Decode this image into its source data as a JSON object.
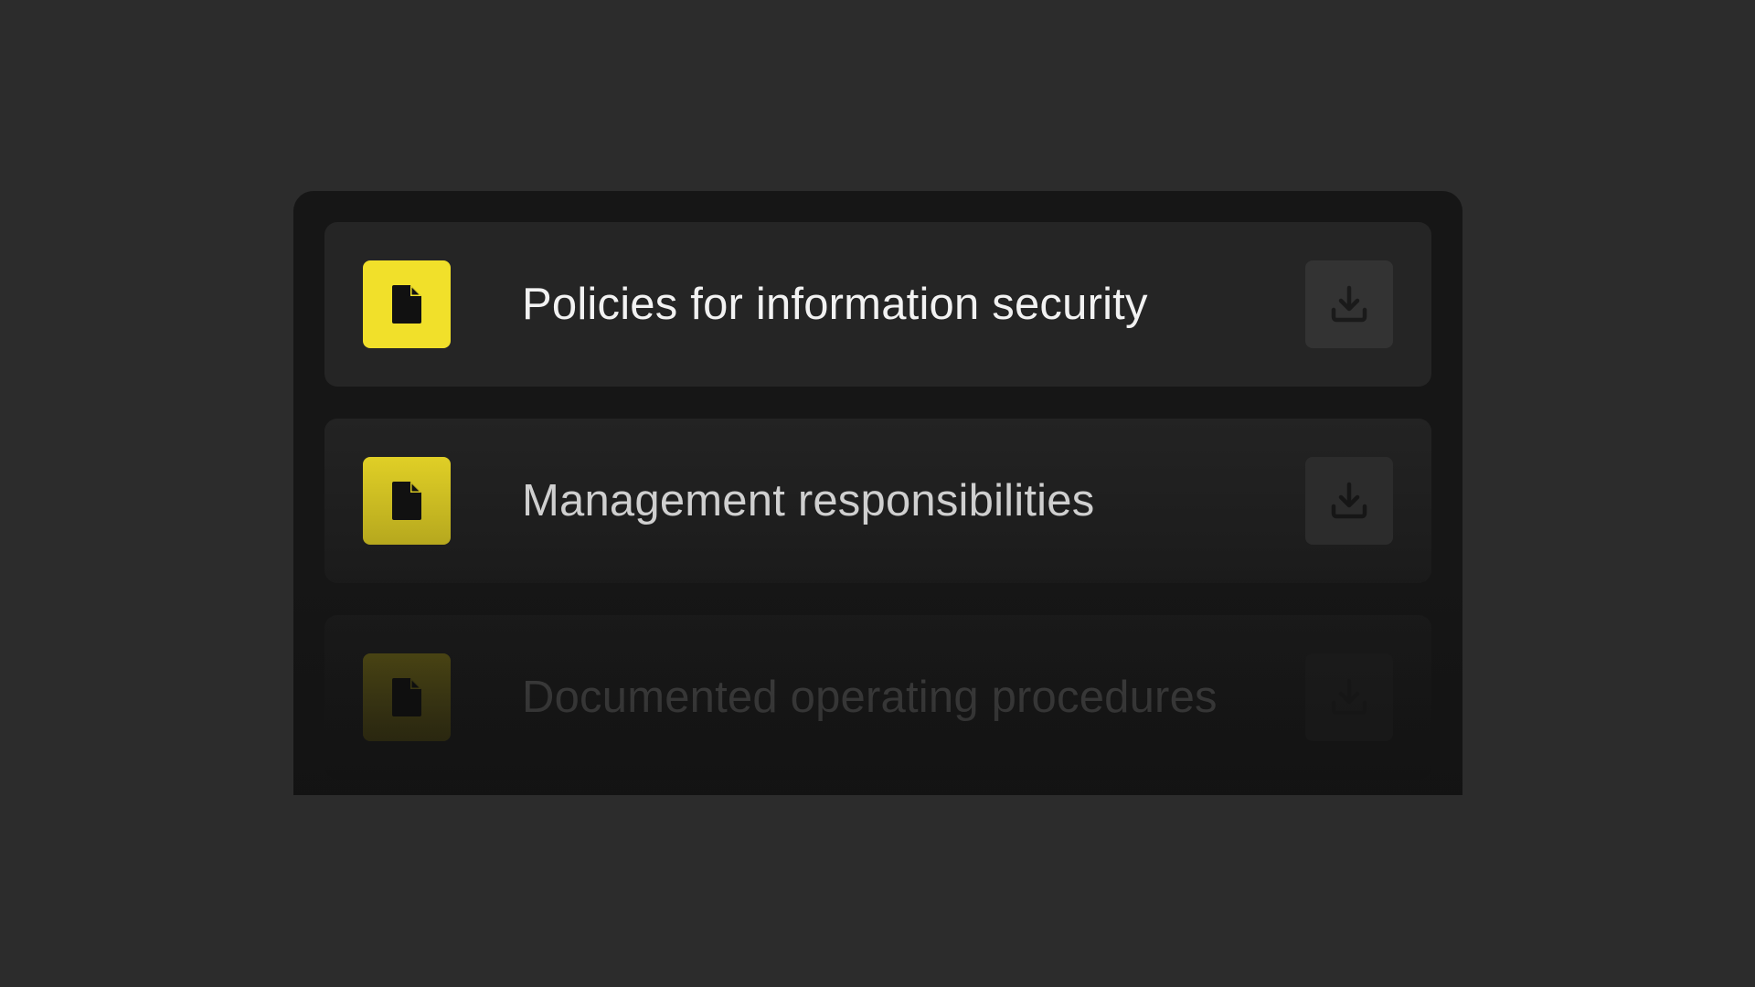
{
  "documents": {
    "items": [
      {
        "title": "Policies for information security",
        "icon": "document-icon",
        "action_icon": "download-icon"
      },
      {
        "title": "Management responsibilities",
        "icon": "document-icon",
        "action_icon": "download-icon"
      },
      {
        "title": "Documented operating procedures",
        "icon": "document-icon",
        "action_icon": "download-icon"
      }
    ]
  },
  "colors": {
    "background": "#2c2c2c",
    "panel": "#161616",
    "row": "#252525",
    "accent": "#f1e02a",
    "text": "#f2f2f2"
  }
}
